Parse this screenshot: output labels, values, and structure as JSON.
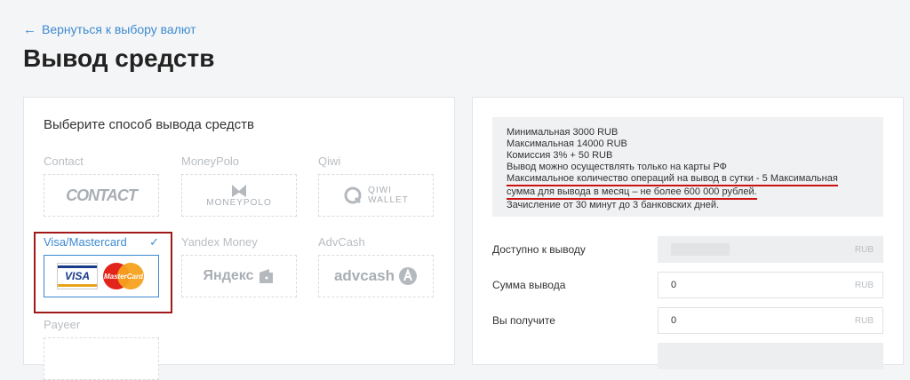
{
  "nav": {
    "back_label": "Вернуться к выбору валют"
  },
  "page": {
    "title": "Вывод средств"
  },
  "left": {
    "heading": "Выберите способ вывода средств",
    "methods": [
      {
        "label": "Contact",
        "logo": "CONTACT"
      },
      {
        "label": "MoneyPolo",
        "logo": "MONEYPOLO"
      },
      {
        "label": "Qiwi",
        "logo_line1": "QIWI",
        "logo_line2": "WALLET"
      },
      {
        "label": "Visa/Mastercard",
        "logo_visa": "VISA",
        "logo_mc": "MasterCard",
        "selected": true
      },
      {
        "label": "Yandex Money",
        "logo": "Яндекс"
      },
      {
        "label": "AdvCash",
        "logo": "advcash"
      },
      {
        "label": "Payeer"
      }
    ]
  },
  "right": {
    "info": {
      "line1": "Минимальная 3000 RUB",
      "line2": "Максимальная 14000 RUB",
      "line3": "Комиссия 3% + 50 RUB",
      "line4": "Вывод можно осуществлять только на карты РФ",
      "line5": "Максимальное количество операций на вывод в сутки - 5 Максимальная",
      "line6": "сумма для вывода в месяц – не более 600 000 рублей.",
      "line7": "Зачисление от 30 минут до 3 банковских дней."
    },
    "available": {
      "label": "Доступно к выводу",
      "currency": "RUB"
    },
    "amount": {
      "label": "Сумма вывода",
      "value": "0",
      "currency": "RUB"
    },
    "receive": {
      "label": "Вы получите",
      "value": "0",
      "currency": "RUB"
    }
  },
  "colors": {
    "accent": "#3d8ad1",
    "highlight": "#a01818",
    "underline": "#cc1111"
  }
}
